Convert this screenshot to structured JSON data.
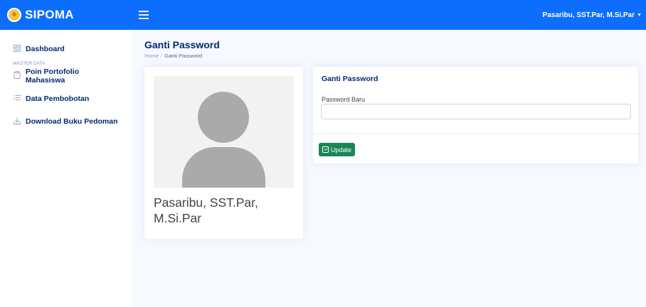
{
  "header": {
    "brand": "SIPOMA",
    "user_name": "Pasaribu, SST.Par, M.Si.Par",
    "color": "#0d6efd"
  },
  "sidebar": {
    "items": [
      {
        "label": "Dashboard",
        "icon": "grid-icon"
      },
      {
        "heading": "MASTER DATA"
      },
      {
        "label": "Poin Portofolio Mahasiswa",
        "icon": "clipboard-icon"
      },
      {
        "label": "Data Pembobotan",
        "icon": "list-icon"
      },
      {
        "label": "Download Buku Pedoman",
        "icon": "download-icon"
      }
    ]
  },
  "page": {
    "title": "Ganti Password",
    "breadcrumb": [
      "Home",
      "Ganti Password"
    ]
  },
  "profile": {
    "name": "Pasaribu, SST.Par, M.Si.Par",
    "avatar": "user-silhouette-icon"
  },
  "password_form": {
    "title": "Ganti Password",
    "label": "Password Baru",
    "value": "",
    "placeholder": "",
    "button_label": "Update",
    "button_color": "#198754"
  }
}
